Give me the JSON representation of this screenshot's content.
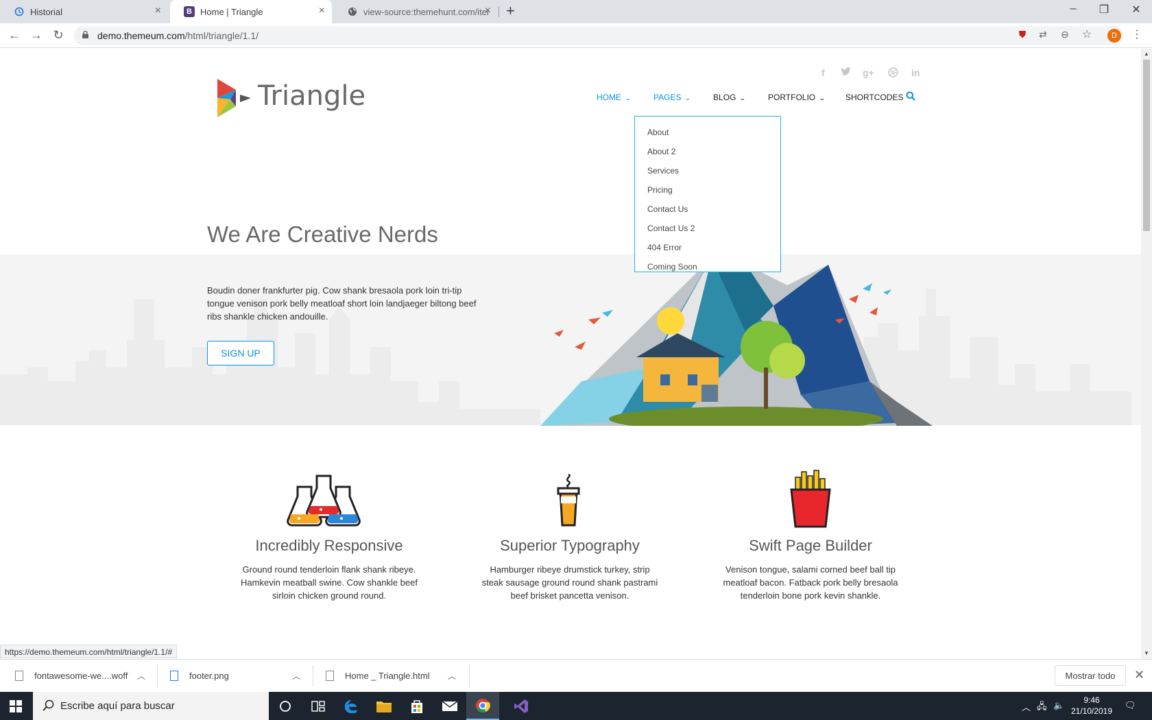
{
  "browser": {
    "tabs": [
      {
        "title": "Historial",
        "active": false
      },
      {
        "title": "Home | Triangle",
        "active": true
      },
      {
        "title": "view-source:themehunt.com/item",
        "active": false
      }
    ],
    "url_host": "demo.themeum.com",
    "url_path": "/html/triangle/1.1/",
    "avatar_letter": "D",
    "status_url": "https://demo.themeum.com/html/triangle/1.1/#"
  },
  "site": {
    "logo_text": "Triangle",
    "social_icons": [
      "facebook-icon",
      "twitter-icon",
      "google-plus-icon",
      "dribbble-icon",
      "linkedin-icon"
    ],
    "nav": [
      {
        "label": "HOME",
        "has_caret": true,
        "active": true
      },
      {
        "label": "PAGES",
        "has_caret": true,
        "active": true
      },
      {
        "label": "BLOG",
        "has_caret": true,
        "active": false
      },
      {
        "label": "PORTFOLIO",
        "has_caret": true,
        "active": false
      },
      {
        "label": "SHORTCODES",
        "has_caret": false,
        "active": false
      }
    ],
    "pages_dropdown": [
      "About",
      "About 2",
      "Services",
      "Pricing",
      "Contact Us",
      "Contact Us 2",
      "404 Error",
      "Coming Soon"
    ],
    "hero": {
      "title": "We Are Creative Nerds",
      "text": "Boudin doner frankfurter pig. Cow shank bresaola pork loin tri-tip tongue venison pork belly meatloaf short loin landjaeger biltong beef ribs shankle chicken andouille.",
      "button": "SIGN UP"
    },
    "features": [
      {
        "title": "Incredibly Responsive",
        "text": "Ground round tenderloin flank shank ribeye. Hamkevin meatball swine. Cow shankle beef sirloin chicken ground round.",
        "icon": "flasks-icon"
      },
      {
        "title": "Superior Typography",
        "text": "Hamburger ribeye drumstick turkey, strip steak sausage ground round shank pastrami beef brisket pancetta venison.",
        "icon": "coffee-cup-icon"
      },
      {
        "title": "Swift Page Builder",
        "text": "Venison tongue, salami corned beef ball tip meatloaf bacon. Fatback pork belly bresaola tenderloin bone pork kevin shankle.",
        "icon": "fries-icon"
      }
    ],
    "accent_color": "#0b92d8"
  },
  "downloads": {
    "items": [
      "fontawesome-we....woff",
      "footer.png",
      "Home _ Triangle.html"
    ],
    "show_all": "Mostrar todo"
  },
  "taskbar": {
    "search_placeholder": "Escribe aquí para buscar",
    "time": "9:46",
    "date": "21/10/2019"
  }
}
